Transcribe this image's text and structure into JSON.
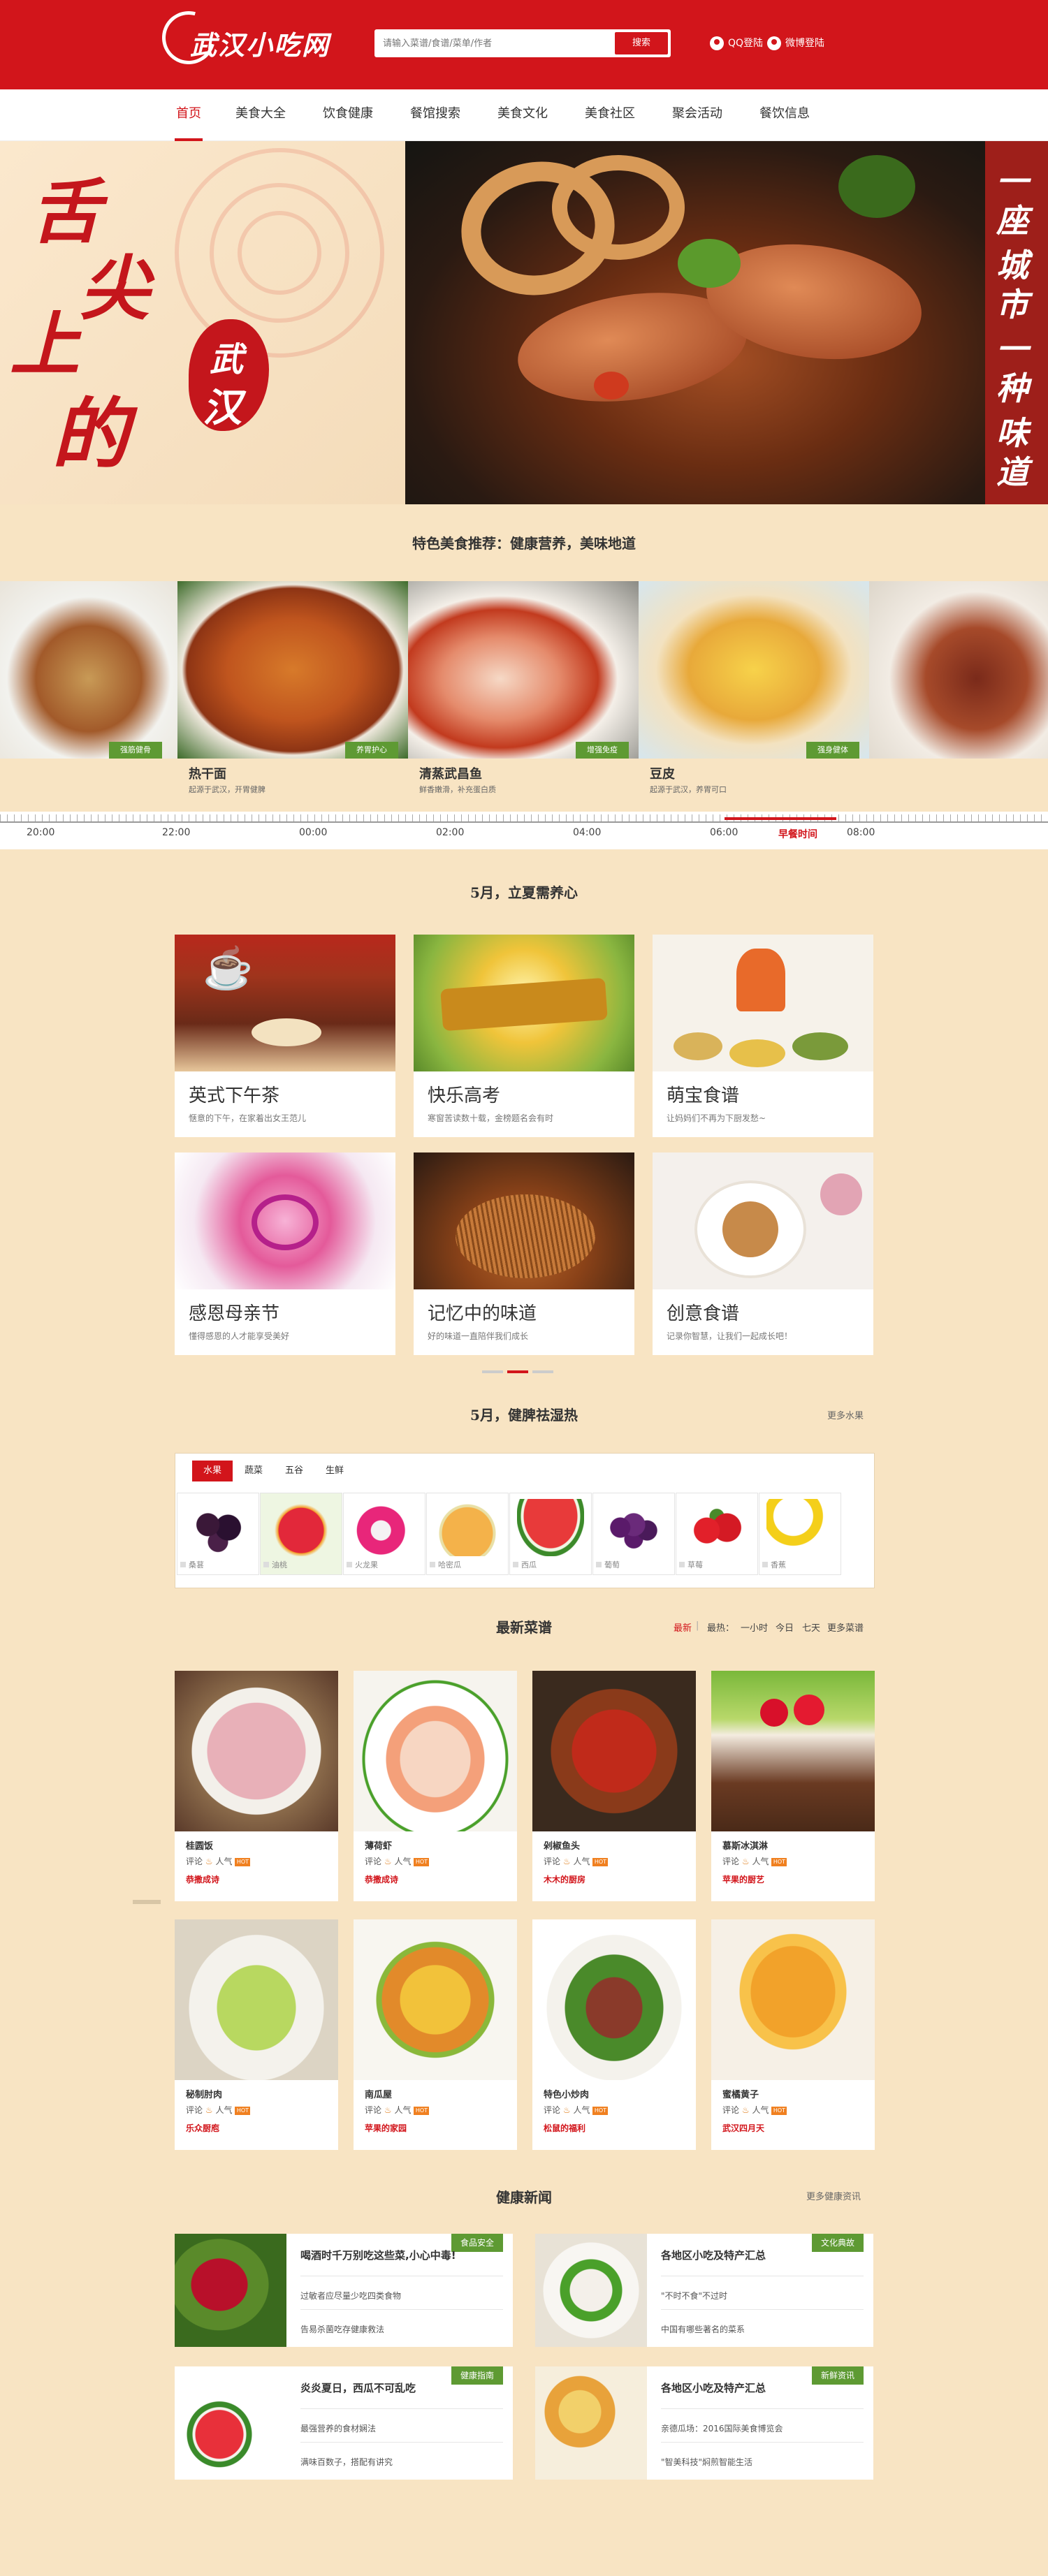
{
  "header": {
    "logo_text": "武汉小吃网",
    "search_placeholder": "请输入菜谱/食谱/菜单/作者",
    "search_button": "搜索",
    "qq_login": "QQ登陆",
    "weibo_login": "微博登陆"
  },
  "nav": [
    "首页",
    "美食大全",
    "饮食健康",
    "餐馆搜索",
    "美食文化",
    "美食社区",
    "聚会活动",
    "餐饮信息"
  ],
  "banner": {
    "slogan_chars": [
      "舌",
      "尖",
      "上",
      "的"
    ],
    "seal_chars": [
      "武",
      "汉"
    ],
    "side_text": [
      "一座",
      "城市",
      "一种",
      "味道"
    ]
  },
  "featured": {
    "title": "特色美食推荐：健康营养，美味地道",
    "items": [
      {
        "name": "",
        "desc": "",
        "tag": "强筋健骨"
      },
      {
        "name": "热干面",
        "desc": "起源于武汉，开胃健脾",
        "tag": "养胃护心"
      },
      {
        "name": "清蒸武昌鱼",
        "desc": "鲜香嫩滑，补充蛋白质",
        "tag": "增强免疫"
      },
      {
        "name": "豆皮",
        "desc": "起源于武汉，养胃可口",
        "tag": "强身健体"
      },
      {
        "name": "",
        "desc": "",
        "tag": ""
      }
    ],
    "timeline": [
      "20:00",
      "22:00",
      "00:00",
      "02:00",
      "04:00",
      "06:00",
      "早餐时间",
      "08:00"
    ]
  },
  "season": {
    "title": "5月，立夏需养心",
    "cards": [
      {
        "title": "英式下午茶",
        "desc": "惬意的下午，在家着出女王范儿"
      },
      {
        "title": "快乐高考",
        "desc": "寒窗苦读数十载，金榜题名会有时"
      },
      {
        "title": "萌宝食谱",
        "desc": "让妈妈们不再为下厨发愁~"
      },
      {
        "title": "感恩母亲节",
        "desc": "懂得感恩的人才能享受美好"
      },
      {
        "title": "记忆中的味道",
        "desc": "好的味道一直陪伴我们成长"
      },
      {
        "title": "创意食谱",
        "desc": "记录你智慧，让我们一起成长吧！"
      }
    ]
  },
  "fruits": {
    "title": "5月，健脾祛湿热",
    "more": "更多水果",
    "tabs": [
      "水果",
      "蔬菜",
      "五谷",
      "生鲜"
    ],
    "items": [
      "桑葚",
      "油桃",
      "火龙果",
      "哈密瓜",
      "西瓜",
      "葡萄",
      "草莓",
      "香蕉"
    ]
  },
  "recipes": {
    "title": "最新菜谱",
    "filters": [
      "最新",
      "|",
      "最热：",
      "一小时",
      "今日",
      "七天",
      "更多菜谱"
    ],
    "meta_label": "评论",
    "pop_label": "人气",
    "hot": "HOT",
    "items": [
      {
        "name": "桂圆饭",
        "author": "恭撒成诗"
      },
      {
        "name": "薄荷虾",
        "author": "恭撒成诗"
      },
      {
        "name": "剁椒鱼头",
        "author": "木木的厨房"
      },
      {
        "name": "慕斯冰淇淋",
        "author": "苹果的厨艺"
      },
      {
        "name": "秘制肘肉",
        "author": "乐众厨庖"
      },
      {
        "name": "南瓜屋",
        "author": "苹果的家园"
      },
      {
        "name": "特色小炒肉",
        "author": "松鼠的福利"
      },
      {
        "name": "蜜橘黄子",
        "author": "武汉四月天"
      }
    ]
  },
  "news": {
    "title": "健康新闻",
    "more": "更多健康资讯",
    "items": [
      {
        "tag": "食品安全",
        "title": "喝酒时千万别吃这些菜,小心中毒!",
        "lines": [
          "过敏者应尽量少吃四类食物",
          "告易杀菌吃存健康救法"
        ]
      },
      {
        "tag": "文化典故",
        "title": "各地区小吃及特产汇总",
        "lines": [
          "\"不时不食\"不过时",
          "中国有哪些著名的菜系"
        ]
      },
      {
        "tag": "健康指南",
        "title": "炎炎夏日，西瓜不可乱吃",
        "lines": [
          "最强营养的食材娴法",
          "满味百数子，搭配有讲究"
        ]
      },
      {
        "tag": "新鲜资讯",
        "title": "各地区小吃及特产汇总",
        "lines": [
          "亲德瓜场：2016国际美食博览会",
          "\"智美科技\"焖煎智能生活"
        ]
      }
    ]
  },
  "colors": {
    "brand_red": "#d2151b",
    "page_bg": "#f8e4c3",
    "tag_green": "#5e9a33"
  }
}
